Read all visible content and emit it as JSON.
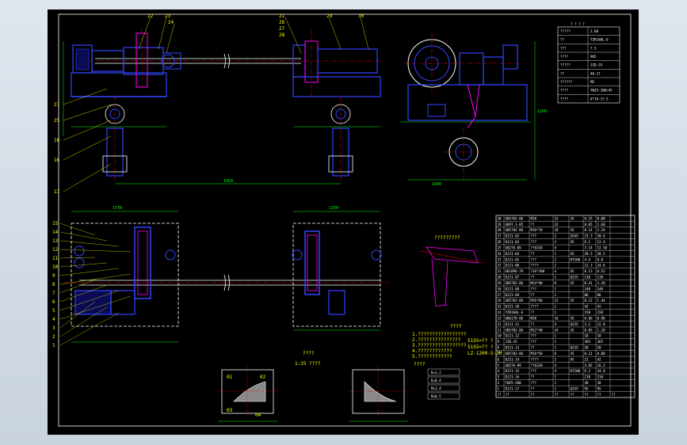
{
  "drawing": {
    "front_view_labels": [
      "22",
      "23",
      "24",
      "21",
      "26",
      "27",
      "28",
      "29",
      "30"
    ],
    "left_labels_top": [
      "27",
      "25",
      "10",
      "16",
      "17"
    ],
    "left_labels_plan": [
      "15",
      "14",
      "13",
      "12",
      "11",
      "10",
      "9",
      "8",
      "7",
      "6",
      "5",
      "4",
      "3",
      "2",
      "1"
    ],
    "dim_span": "1450",
    "dim_left": "1790",
    "dim_right": "1150",
    "plan_top_left": "1730",
    "plan_top_right": "1150",
    "side_dim_w": "1840",
    "side_dim_h": "1200",
    "detail_title": "????",
    "detail_subtitle": "1:25 ????",
    "detail_label": "?????????",
    "notes_title": "????",
    "notes_lines": [
      "1.?????????????????",
      "2.???????????????",
      "3.?????????????????",
      "4.????????????",
      "5.????????????"
    ],
    "tech_block_title": "????",
    "tech_rows": [
      "D=3.2",
      "D=0.4",
      "M=1.4",
      "M=0.5"
    ],
    "spec_note": "S1S5=?? ?",
    "spec_note2": "S1S5=?? ?",
    "spec_note3": "LZ-1200-5-JM",
    "zero_marks": [
      "01",
      "02",
      "03",
      "04"
    ]
  },
  "params_table": {
    "title": "? ? ? ?",
    "rows": [
      [
        "?????",
        "2.88"
      ],
      [
        "??",
        "YZR160L-6"
      ],
      [
        "???",
        "7.5"
      ],
      [
        "????",
        "965"
      ],
      [
        "?????",
        "JZQ-35"
      ],
      [
        "??",
        "40.17"
      ],
      [
        "??????",
        "M5"
      ],
      [
        "????",
        "YWZ5-200/45"
      ],
      [
        "????",
        "6*19-17.5"
      ]
    ]
  },
  "parts_table": {
    "rows": [
      [
        "30",
        "GB5782-86",
        "M20",
        "32",
        "35",
        "0.25",
        "8.00",
        ""
      ],
      [
        "29",
        "GB97.1-85",
        "??",
        "32",
        "",
        "0.05",
        "1.60",
        ""
      ],
      [
        "28",
        "GB5782-86",
        "M16*70",
        "16",
        "35",
        "0.14",
        "2.24",
        ""
      ],
      [
        "27",
        "DJ21-02",
        "???",
        "2",
        "ZG45",
        "15.3",
        "30.6",
        ""
      ],
      [
        "26",
        "DJ21-03",
        "???",
        "2",
        "45",
        "6.2",
        "12.4",
        ""
      ],
      [
        "25",
        "GB276-89",
        "??6318",
        "4",
        "",
        "3.14",
        "12.56",
        ""
      ],
      [
        "24",
        "DJ21-04",
        "??",
        "1",
        "45",
        "28.5",
        "28.5",
        ""
      ],
      [
        "23",
        "DJ21-05",
        "???",
        "2",
        "HT200",
        "4.4",
        "8.8",
        ""
      ],
      [
        "22",
        "DJ21-06",
        "????",
        "2",
        "",
        "12.3",
        "24.6",
        ""
      ],
      [
        "21",
        "GB1096-79",
        "?16*100",
        "4",
        "45",
        "0.13",
        "0.52",
        ""
      ],
      [
        "20",
        "DJ21-07",
        "??",
        "1",
        "Q235",
        "110",
        "110",
        ""
      ],
      [
        "19",
        "GB5782-86",
        "M24*90",
        "8",
        "35",
        "0.41",
        "3.28",
        ""
      ],
      [
        "18",
        "DJ21-08",
        "???",
        "1",
        "",
        "140",
        "140",
        ""
      ],
      [
        "17",
        "DJ21-09",
        "??",
        "1",
        "",
        "86",
        "86",
        ""
      ],
      [
        "16",
        "GB5782-86",
        "M16*60",
        "12",
        "35",
        "0.12",
        "1.44",
        ""
      ],
      [
        "15",
        "DJ21-10",
        "????",
        "1",
        "",
        "42",
        "42",
        ""
      ],
      [
        "14",
        "YZR160L-6",
        "??",
        "1",
        "",
        "158",
        "158",
        ""
      ],
      [
        "13",
        "GB6170-86",
        "M20",
        "16",
        "35",
        "0.06",
        "0.96",
        ""
      ],
      [
        "12",
        "DJ21-11",
        "??",
        "4",
        "Q235",
        "3.2",
        "12.8",
        ""
      ],
      [
        "11",
        "GB5782-86",
        "M12*40",
        "24",
        "35",
        "0.05",
        "1.20",
        ""
      ],
      [
        "10",
        "DJ21-12",
        "???",
        "1",
        "",
        "18",
        "18",
        ""
      ],
      [
        "9",
        "JZQ-35",
        "???",
        "1",
        "",
        "365",
        "365",
        ""
      ],
      [
        "8",
        "DJ21-13",
        "??",
        "1",
        "Q235",
        "58",
        "58",
        ""
      ],
      [
        "7",
        "GB5782-86",
        "M16*50",
        "8",
        "35",
        "0.11",
        "0.88",
        ""
      ],
      [
        "6",
        "DJ21-14",
        "????",
        "2",
        "45",
        "21",
        "42",
        ""
      ],
      [
        "5",
        "GB276-89",
        "??6320",
        "4",
        "",
        "4.05",
        "16.2",
        ""
      ],
      [
        "4",
        "DJ21-15",
        "???",
        "4",
        "HT200",
        "6.2",
        "24.8",
        ""
      ],
      [
        "3",
        "DJ21-16",
        "??",
        "1",
        "",
        "210",
        "210",
        ""
      ],
      [
        "2",
        "YWZ5-200",
        "???",
        "1",
        "",
        "38",
        "38",
        ""
      ],
      [
        "1",
        "DJ21-17",
        "??",
        "1",
        "Q235",
        "95",
        "95",
        ""
      ]
    ],
    "header": [
      "??",
      "??",
      "??",
      "??",
      "??",
      "??",
      "??",
      "??"
    ]
  },
  "colors": {
    "background": "#000000",
    "frame": "#ffffff",
    "part": "#0000ff",
    "part_bright": "#3344ff",
    "center": "#ff0000",
    "dimension": "#00ff00",
    "label": "#ffff00",
    "hatch": "#ffffff",
    "detail": "#ff00ff"
  }
}
